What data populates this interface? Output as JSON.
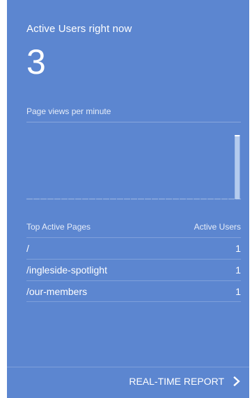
{
  "card": {
    "title": "Active Users right now",
    "active_count": "3",
    "chart_label": "Page views per minute",
    "accent_color": "#5c86d0"
  },
  "chart_data": {
    "type": "bar",
    "title": "",
    "series": [
      {
        "values": [
          0,
          0,
          0,
          0,
          0,
          0,
          0,
          0,
          0,
          0,
          0,
          0,
          0,
          0,
          0,
          0,
          0,
          0,
          0,
          0,
          0,
          0,
          0,
          0,
          0,
          0,
          0,
          0,
          0,
          1
        ]
      }
    ],
    "ylim": [
      0,
      1
    ],
    "grid": false
  },
  "table": {
    "headers": [
      "Top Active Pages",
      "Active Users"
    ],
    "rows": [
      {
        "page": "/",
        "users": "1"
      },
      {
        "page": "/ingleside-spotlight",
        "users": "1"
      },
      {
        "page": "/our-members",
        "users": "1"
      }
    ]
  },
  "footer": {
    "link_label": "REAL-TIME REPORT",
    "icon": "chevron-right-icon"
  }
}
